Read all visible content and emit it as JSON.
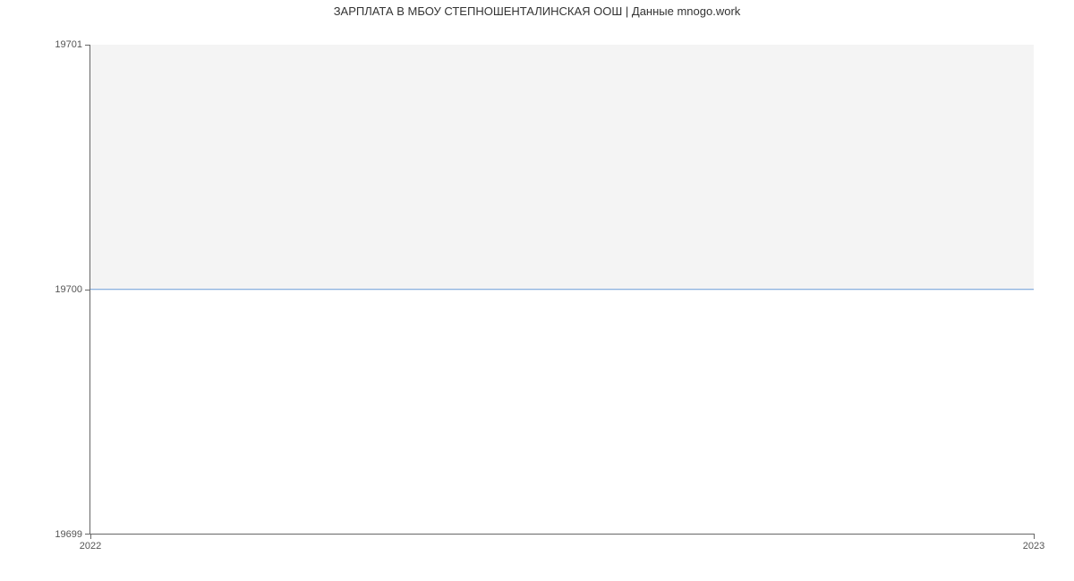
{
  "chart_data": {
    "type": "area",
    "title": "ЗАРПЛАТА В МБОУ СТЕПНОШЕНТАЛИНСКАЯ ООШ | Данные mnogo.work",
    "x": [
      2022,
      2023
    ],
    "values": [
      19700,
      19700
    ],
    "xlabel": "",
    "ylabel": "",
    "ylim": [
      19699,
      19701
    ],
    "xlim": [
      2022,
      2023
    ],
    "y_ticks": [
      19699,
      19700,
      19701
    ],
    "x_ticks": [
      2022,
      2023
    ],
    "line_color": "#6b9bd8",
    "fill_color": "#f4f4f4"
  }
}
